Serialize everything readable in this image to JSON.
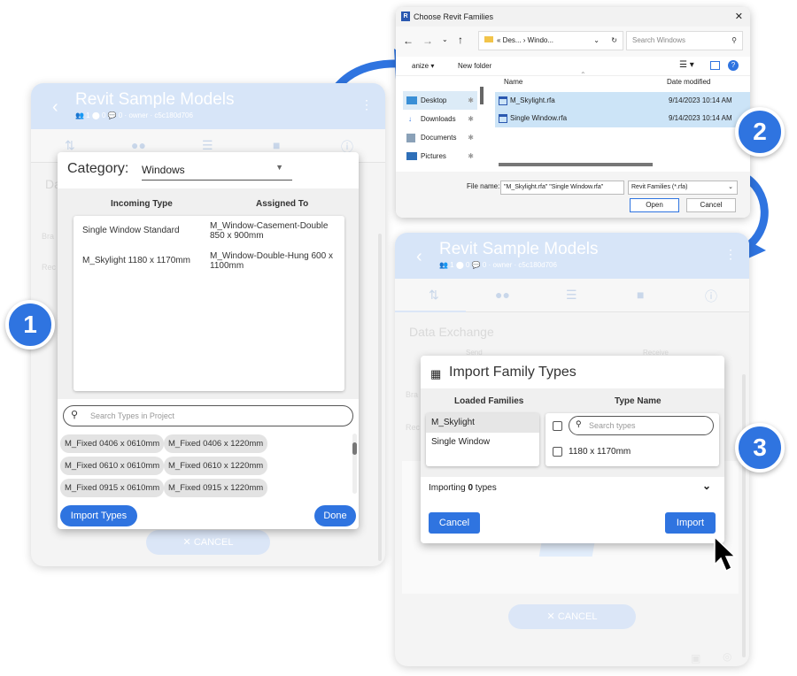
{
  "colors": {
    "accent": "#2f74e0",
    "header": "#d7e5f8"
  },
  "panel_left": {
    "title": "Revit Sample Models",
    "subtitle": "👥 1 ⬤ 0 💬 0 · owner · c5c180d706",
    "faint": {
      "da": "Da",
      "bra": "Bra",
      "rec": "Rec"
    },
    "cancel": "✕  CANCEL"
  },
  "dialog1": {
    "category_label": "Category:",
    "category_value": "Windows",
    "col_incoming": "Incoming Type",
    "col_assigned": "Assigned To",
    "rows": [
      {
        "incoming": "Single Window Standard",
        "assigned": "M_Window-Casement-Double 850 x 900mm"
      },
      {
        "incoming": "M_Skylight 1180 x 1170mm",
        "assigned": "M_Window-Double-Hung 600 x 1100mm"
      }
    ],
    "search_placeholder": "Search Types in Project",
    "chips": [
      "M_Fixed 0406 x 0610mm",
      "M_Fixed 0406 x 1220mm",
      "M_Fixed 0610 x 0610mm",
      "M_Fixed 0610 x 1220mm",
      "M_Fixed 0915 x 0610mm",
      "M_Fixed 0915 x 1220mm"
    ],
    "import_btn": "Import Types",
    "done_btn": "Done"
  },
  "explorer": {
    "title": "Choose Revit Families",
    "address": "«  Des...  ›  Windo...",
    "search": "Search Windows",
    "organize": "anize ▾",
    "new_folder": "New folder",
    "col_name": "Name",
    "col_date": "Date modified",
    "tree": [
      "Desktop",
      "Downloads",
      "Documents",
      "Pictures"
    ],
    "files": [
      {
        "name": "M_Skylight.rfa",
        "date": "9/14/2023 10:14 AM"
      },
      {
        "name": "Single Window.rfa",
        "date": "9/14/2023 10:14 AM"
      }
    ],
    "filename_label": "File name:",
    "filename_value": "\"M_Skylight.rfa\" \"Single Window.rfa\"",
    "filter": "Revit Families (*.rfa)",
    "open": "Open",
    "cancel": "Cancel"
  },
  "panel_right": {
    "title": "Revit Sample Models",
    "subtitle": "👥 1 ⬤ 0 💬 0 · owner · c5c180d706",
    "data_exchange": "Data Exchange",
    "send": "Send",
    "receive": "Receive",
    "faint": {
      "bra": "Bra",
      "rec": "Rec"
    },
    "cancel": "✕  CANCEL"
  },
  "dialog3": {
    "title": "Import Family Types",
    "col_loaded": "Loaded Families",
    "col_type": "Type Name",
    "families": [
      "M_Skylight",
      "Single Window"
    ],
    "search_placeholder": "Search types",
    "type_item": "1180 x 1170mm",
    "importing_prefix": "Importing ",
    "importing_count": "0",
    "importing_suffix": " types",
    "cancel": "Cancel",
    "import": "Import"
  },
  "badges": [
    "1",
    "2",
    "3"
  ]
}
